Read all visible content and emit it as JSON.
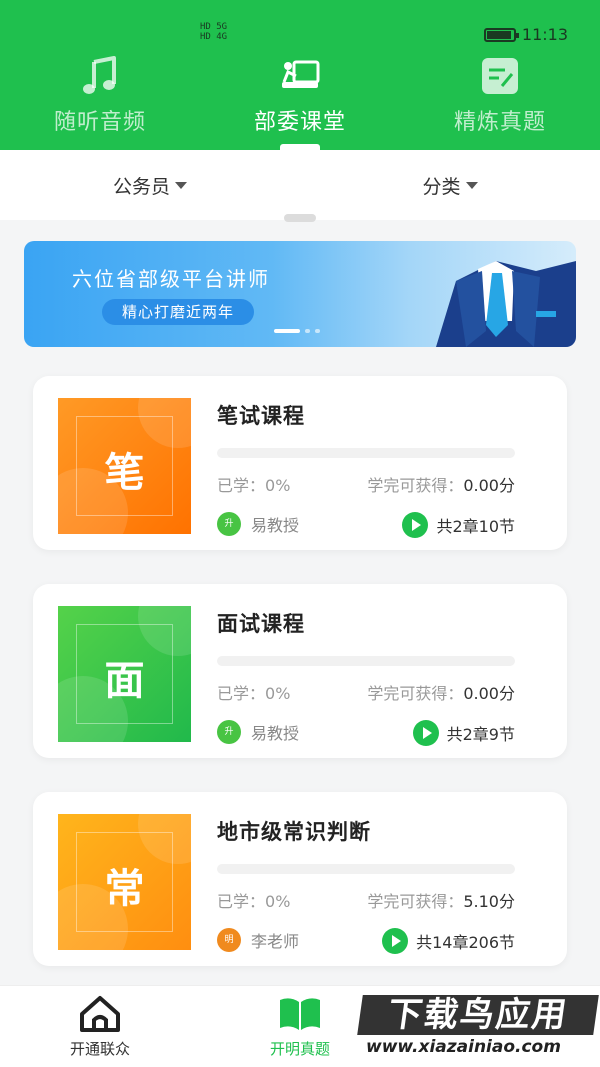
{
  "status_bar": {
    "network": [
      "HD 5G",
      "HD 4G"
    ],
    "time": "11:13"
  },
  "top_tabs": [
    {
      "label": "随听音频",
      "icon": "music-note-icon",
      "active": false
    },
    {
      "label": "部委课堂",
      "icon": "classroom-board-icon",
      "active": true
    },
    {
      "label": "精炼真题",
      "icon": "edit-note-icon",
      "active": false
    }
  ],
  "filters": {
    "exam_type": "公务员",
    "category": "分类"
  },
  "banner": {
    "title": "六位省部级平台讲师",
    "subtitle": "精心打磨近两年",
    "slide_count": 3,
    "active_slide": 1
  },
  "courses": [
    {
      "title": "笔试课程",
      "thumb_char": "笔",
      "thumb_color": "orange",
      "learned_label": "已学：",
      "learned_value": "0%",
      "progress": 0,
      "reward_label": "学完可获得：",
      "reward_value": "0.00分",
      "teacher_badge": "升",
      "teacher_badge_color": "#48c443",
      "teacher": "易教授",
      "chapters": "共2章10节"
    },
    {
      "title": "面试课程",
      "thumb_char": "面",
      "thumb_color": "green",
      "learned_label": "已学：",
      "learned_value": "0%",
      "progress": 0,
      "reward_label": "学完可获得：",
      "reward_value": "0.00分",
      "teacher_badge": "升",
      "teacher_badge_color": "#48c443",
      "teacher": "易教授",
      "chapters": "共2章9节"
    },
    {
      "title": "地市级常识判断",
      "thumb_char": "常",
      "thumb_color": "amber",
      "learned_label": "已学：",
      "learned_value": "0%",
      "progress": 0,
      "reward_label": "学完可获得：",
      "reward_value": "5.10分",
      "teacher_badge": "明",
      "teacher_badge_color": "#f08a1e",
      "teacher": "李老师",
      "chapters": "共14章206节"
    }
  ],
  "bottom_nav": [
    {
      "label": "开通联众",
      "icon": "home-icon",
      "active": false
    },
    {
      "label": "开明真题",
      "icon": "open-book-icon",
      "active": true
    }
  ],
  "watermark": {
    "brand": "下载鸟应用",
    "url": "www.xiazainiao.com"
  },
  "colors": {
    "brand_green": "#1fc04e",
    "banner_blue": "#3aa4f3"
  }
}
